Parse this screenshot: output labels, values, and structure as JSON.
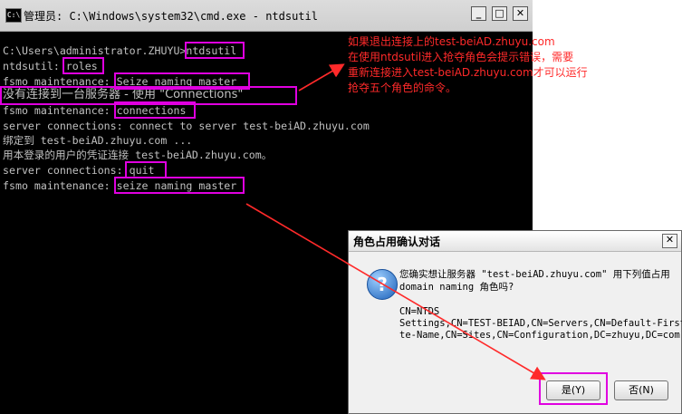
{
  "cmd_window": {
    "title": "管理员: C:\\Windows\\system32\\cmd.exe - ntdsutil",
    "icon_label": "C:\\",
    "buttons": {
      "minimize": "_",
      "maximize": "□",
      "close": "✕"
    },
    "lines": [
      "C:\\Users\\administrator.ZHUYU>ntdsutil",
      "ntdsutil: roles",
      "fsmo maintenance: Seize naming master",
      "没有连接到一台服务器 - 使用 \"Connections\"",
      "fsmo maintenance: connections",
      "server connections: connect to server test-beiAD.zhuyu.com",
      "绑定到 test-beiAD.zhuyu.com ...",
      "用本登录的用户的凭证连接 test-beiAD.zhuyu.com。",
      "server connections: quit",
      "fsmo maintenance: seize naming master"
    ]
  },
  "annotation": {
    "lines": [
      "如果退出连接上的test-beiAD.zhuyu.com",
      "在使用ntdsutil进入抢夺角色会提示错误，需要",
      "重新连接进入test-beiAD.zhuyu.com才可以运行",
      "抢夺五个角色的命令。"
    ],
    "color": "#ff2a2a"
  },
  "dialog": {
    "title": "角色占用确认对话",
    "close": "✕",
    "question_icon": "?",
    "message": [
      "您确实想让服务器 \"test-beiAD.zhuyu.com\" 用下列值占用",
      "domain naming 角色吗?"
    ],
    "details": [
      "CN=NTDS",
      "Settings,CN=TEST-BEIAD,CN=Servers,CN=Default-First-Si",
      "te-Name,CN=Sites,CN=Configuration,DC=zhuyu,DC=com"
    ],
    "yes_label": "是(Y)",
    "no_label": "否(N)"
  },
  "highlight_color": "#e000e0"
}
